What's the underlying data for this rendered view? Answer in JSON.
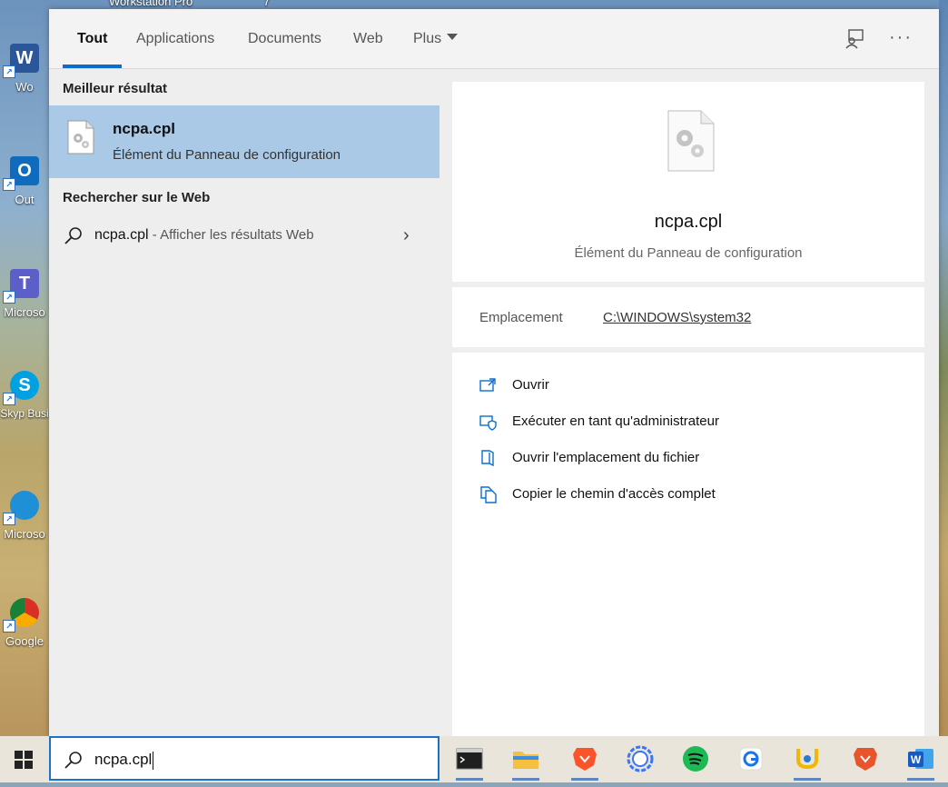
{
  "desktop": {
    "top_labels": [
      "Workstation Pro",
      "7"
    ],
    "icons": [
      {
        "name": "word-shortcut",
        "letter": "W",
        "label": "Wo",
        "color": "#2b579a"
      },
      {
        "name": "outlook-shortcut",
        "letter": "O",
        "label": "Out",
        "color": "#0f6cbd"
      },
      {
        "name": "teams-shortcut",
        "letter": "T",
        "label": "Microso",
        "color": "#5b5fc7"
      },
      {
        "name": "skype-shortcut",
        "letter": "S",
        "label": "Skyp Busi",
        "color": "#00a1e0"
      },
      {
        "name": "edge-shortcut",
        "letter": "",
        "label": "Microso",
        "color": "#1f8fd6"
      },
      {
        "name": "chrome-shortcut",
        "letter": "",
        "label": "Google",
        "color": "#d93025"
      }
    ]
  },
  "search_panel": {
    "tabs": [
      {
        "label": "Tout",
        "active": true
      },
      {
        "label": "Applications",
        "active": false
      },
      {
        "label": "Documents",
        "active": false
      },
      {
        "label": "Web",
        "active": false
      },
      {
        "label": "Plus",
        "active": false
      }
    ],
    "best_match": {
      "section_title": "Meilleur résultat",
      "name": "ncpa.cpl",
      "description": "Élément du Panneau de configuration"
    },
    "web": {
      "section_title": "Rechercher sur le Web",
      "query": "ncpa.cpl",
      "suffix": " - Afficher les résultats Web"
    },
    "preview": {
      "name": "ncpa.cpl",
      "description": "Élément du Panneau de configuration",
      "location_label": "Emplacement",
      "location_value": "C:\\WINDOWS\\system32",
      "actions": [
        {
          "label": "Ouvrir",
          "icon": "open-icon"
        },
        {
          "label": "Exécuter en tant qu'administrateur",
          "icon": "shield-admin-icon"
        },
        {
          "label": "Ouvrir l'emplacement du fichier",
          "icon": "folder-location-icon"
        },
        {
          "label": "Copier le chemin d'accès complet",
          "icon": "copy-path-icon"
        }
      ]
    }
  },
  "taskbar": {
    "search_value": "ncpa.cpl",
    "apps": [
      {
        "name": "terminal",
        "open": true
      },
      {
        "name": "file-explorer",
        "open": true
      },
      {
        "name": "brave",
        "open": true
      },
      {
        "name": "signal",
        "open": false
      },
      {
        "name": "spotify",
        "open": false
      },
      {
        "name": "remote-desktop",
        "open": false
      },
      {
        "name": "tool-app",
        "open": true
      },
      {
        "name": "brave-beta",
        "open": false
      },
      {
        "name": "word",
        "open": true
      }
    ]
  },
  "colors": {
    "accent": "#0a6ed1",
    "selection": "#a9c9e6"
  }
}
